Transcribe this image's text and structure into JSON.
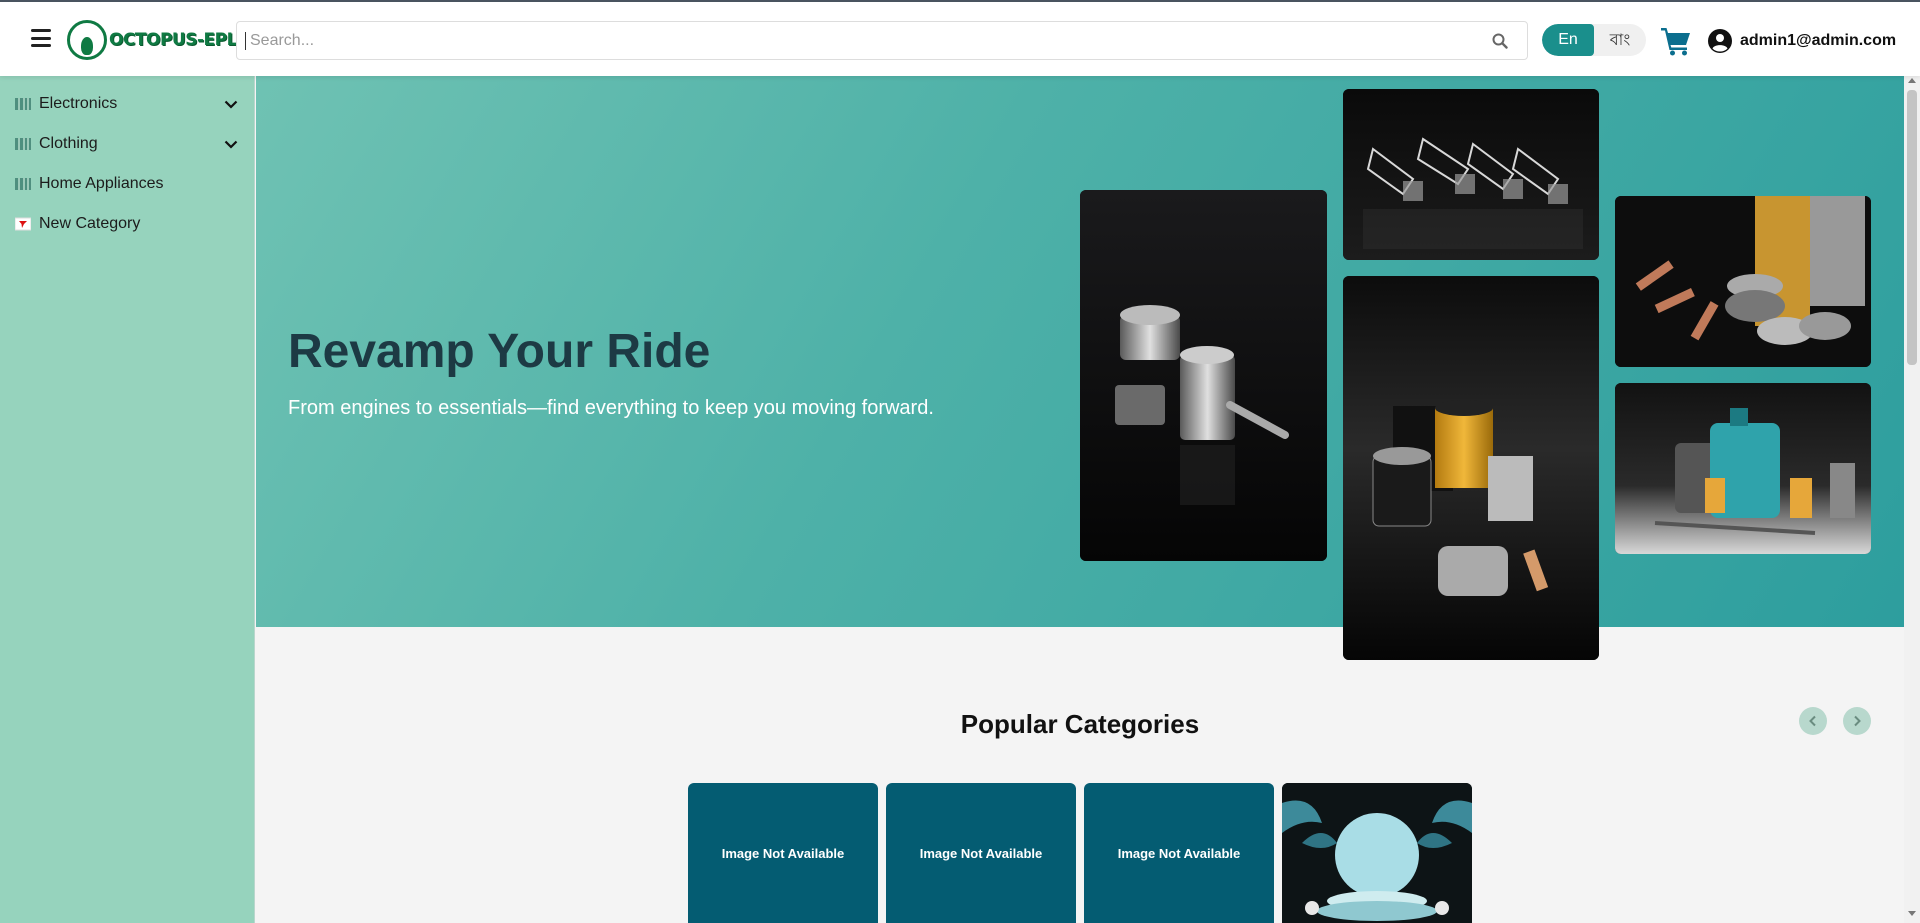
{
  "header": {
    "brand": "OCTOPUS-EPL",
    "search_placeholder": "Search...",
    "lang_en": "En",
    "lang_bn": "বাং",
    "user_label": "admin1@admin.com"
  },
  "sidebar": {
    "items": [
      {
        "label": "Electronics",
        "expandable": true
      },
      {
        "label": "Clothing",
        "expandable": true
      },
      {
        "label": "Home Appliances",
        "expandable": false
      },
      {
        "label": "New Category",
        "expandable": false
      }
    ]
  },
  "hero": {
    "title": "Revamp Your Ride",
    "subtitle": "From engines to essentials—find everything to keep you moving forward."
  },
  "popular": {
    "title": "Popular Categories",
    "cards": [
      {
        "label": "Image Not Available"
      },
      {
        "label": "Image Not Available"
      },
      {
        "label": "Image Not Available"
      },
      {
        "label": ""
      }
    ]
  },
  "colors": {
    "accent": "#1a8f8c",
    "sidebar_bg": "#96d3bd",
    "card_bg": "#045c72",
    "hero_title": "#1d3a44"
  },
  "icons": [
    "menu-icon",
    "search-icon",
    "cart-icon",
    "user-circle-icon",
    "chevron-down-icon",
    "chevron-left-icon",
    "chevron-right-icon"
  ]
}
